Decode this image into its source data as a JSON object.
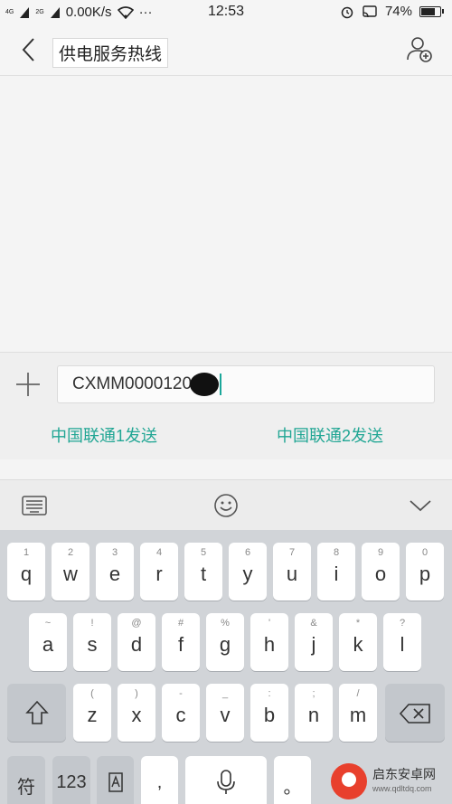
{
  "status_bar": {
    "network_left": "4G",
    "network_right": "2G",
    "speed": "0.00K/s",
    "more": "···",
    "time": "12:53",
    "battery_percent": "74%",
    "battery_level": 0.74
  },
  "header": {
    "title": "供电服务热线"
  },
  "composer": {
    "input_value": "CXMM0000120",
    "send_sim1": "中国联通1发送",
    "send_sim2": "中国联通2发送"
  },
  "keyboard": {
    "row1": [
      {
        "hint": "1",
        "char": "q"
      },
      {
        "hint": "2",
        "char": "w"
      },
      {
        "hint": "3",
        "char": "e"
      },
      {
        "hint": "4",
        "char": "r"
      },
      {
        "hint": "5",
        "char": "t"
      },
      {
        "hint": "6",
        "char": "y"
      },
      {
        "hint": "7",
        "char": "u"
      },
      {
        "hint": "8",
        "char": "i"
      },
      {
        "hint": "9",
        "char": "o"
      },
      {
        "hint": "0",
        "char": "p"
      }
    ],
    "row2": [
      {
        "hint": "~",
        "char": "a"
      },
      {
        "hint": "!",
        "char": "s"
      },
      {
        "hint": "@",
        "char": "d"
      },
      {
        "hint": "#",
        "char": "f"
      },
      {
        "hint": "%",
        "char": "g"
      },
      {
        "hint": "'",
        "char": "h"
      },
      {
        "hint": "&",
        "char": "j"
      },
      {
        "hint": "*",
        "char": "k"
      },
      {
        "hint": "?",
        "char": "l"
      }
    ],
    "row3": [
      {
        "hint": "(",
        "char": "z"
      },
      {
        "hint": ")",
        "char": "x"
      },
      {
        "hint": "-",
        "char": "c"
      },
      {
        "hint": "_",
        "char": "v"
      },
      {
        "hint": ":",
        "char": "b"
      },
      {
        "hint": ";",
        "char": "n"
      },
      {
        "hint": "/",
        "char": "m"
      }
    ],
    "symbol_key": "符",
    "number_key": "123",
    "comma_key": ",",
    "period_key": "。"
  },
  "watermark": {
    "name": "启东安卓网",
    "url": "www.qdltdq.com"
  }
}
